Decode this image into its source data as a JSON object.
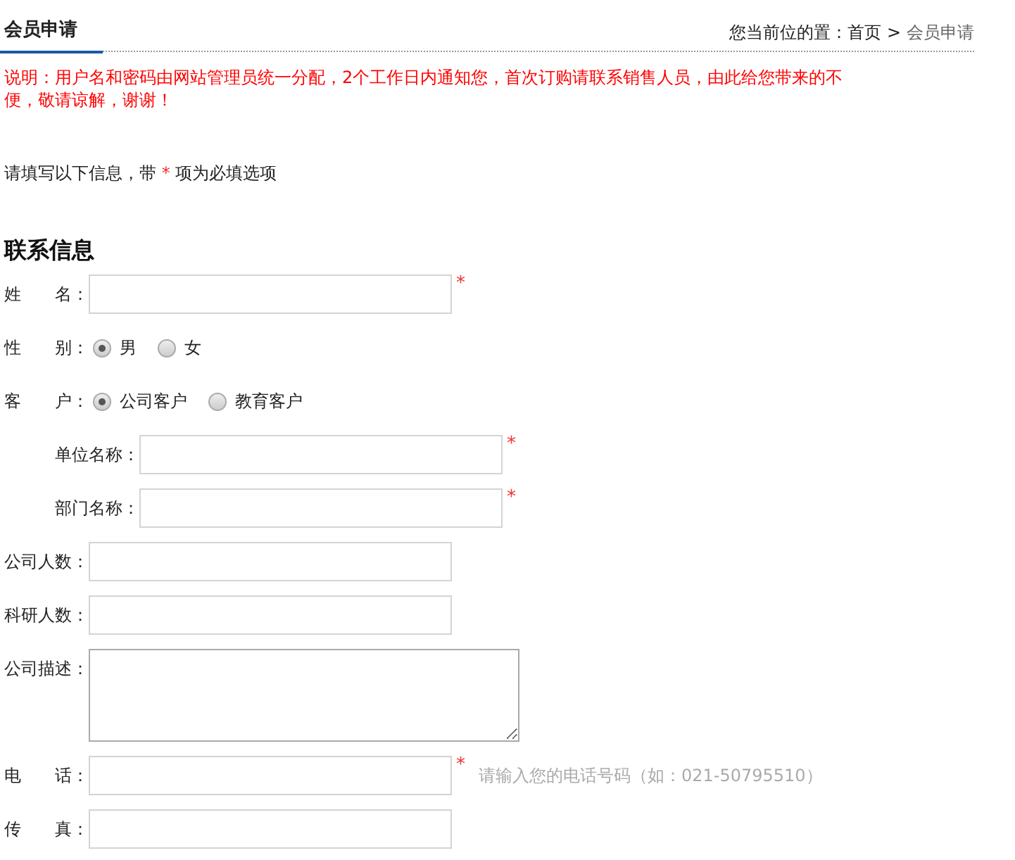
{
  "header": {
    "title": "会员申请",
    "breadcrumb": {
      "prefix": "您当前位的置：",
      "links": [
        {
          "label": "首页"
        }
      ],
      "separator": ">",
      "current": "会员申请"
    }
  },
  "notice": "说明：用户名和密码由网站管理员统一分配，2个工作日内通知您，首次订购请联系销售人员，由此给您带来的不便，敬请谅解，谢谢！",
  "instruction": {
    "before": "请填写以下信息，带 ",
    "mark": "*",
    "after": " 项为必填选项"
  },
  "section_title": "联系信息",
  "rows": [
    {
      "kind": "text",
      "label": "姓　　名：",
      "required": true
    },
    {
      "kind": "radio",
      "label": "性　　别：",
      "options": [
        {
          "label": "男",
          "selected": true
        },
        {
          "label": "女",
          "selected": false
        }
      ]
    },
    {
      "kind": "radio",
      "label": "客　　户：",
      "options": [
        {
          "label": "公司客户",
          "selected": true
        },
        {
          "label": "教育客户",
          "selected": false
        }
      ],
      "children": [
        {
          "kind": "text",
          "label": "单位名称：",
          "required": true
        },
        {
          "kind": "text",
          "label": "部门名称：",
          "required": true
        }
      ]
    },
    {
      "kind": "text",
      "label": "公司人数：",
      "required": false
    },
    {
      "kind": "text",
      "label": "科研人数：",
      "required": false
    },
    {
      "kind": "textarea",
      "label": "公司描述：",
      "required": false
    },
    {
      "kind": "text",
      "label": "电　　话：",
      "required": true,
      "hint": "请输入您的电话号码（如：021-50795510）"
    },
    {
      "kind": "text",
      "label": "传　　真：",
      "required": false
    }
  ]
}
